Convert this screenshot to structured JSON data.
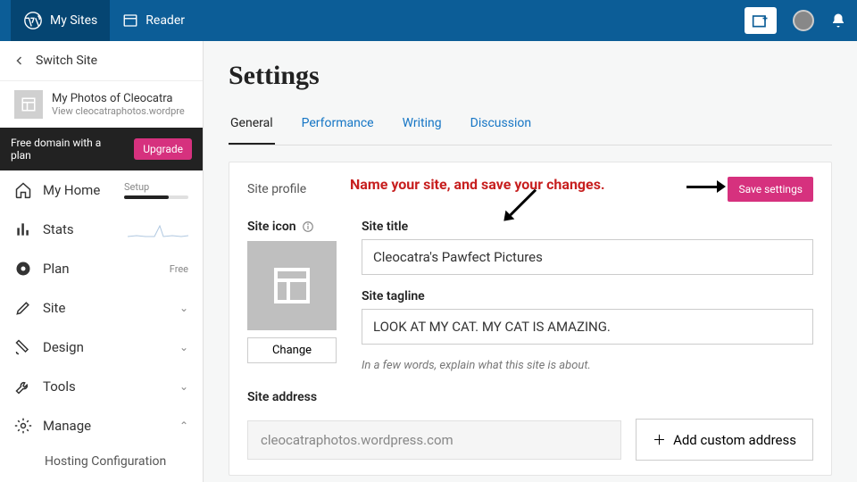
{
  "topbar": {
    "my_sites": "My Sites",
    "reader": "Reader"
  },
  "sidebar": {
    "switch_site": "Switch Site",
    "site_title": "My Photos of Cleocatra",
    "site_url": "View cleocatraphotos.wordpre",
    "upgrade_text": "Free domain with a plan",
    "upgrade_btn": "Upgrade",
    "items": {
      "home": {
        "label": "My Home",
        "meta": "Setup"
      },
      "stats": {
        "label": "Stats"
      },
      "plan": {
        "label": "Plan",
        "meta": "Free"
      },
      "site": {
        "label": "Site"
      },
      "design": {
        "label": "Design"
      },
      "tools": {
        "label": "Tools"
      },
      "manage": {
        "label": "Manage"
      }
    },
    "sub_hosting": "Hosting Configuration"
  },
  "main": {
    "title": "Settings",
    "tabs": {
      "general": "General",
      "performance": "Performance",
      "writing": "Writing",
      "discussion": "Discussion"
    },
    "profile": {
      "section_label": "Site profile",
      "save_btn": "Save settings",
      "annotation": "Name your site, and save your changes.",
      "site_icon_label": "Site icon",
      "change_btn": "Change",
      "site_title_label": "Site title",
      "site_title_value": "Cleocatra's Pawfect Pictures",
      "site_tagline_label": "Site tagline",
      "site_tagline_value": "LOOK AT MY CAT. MY CAT IS AMAZING.",
      "tagline_hint": "In a few words, explain what this site is about.",
      "site_address_label": "Site address",
      "site_address_value": "cleocatraphotos.wordpress.com",
      "custom_address_btn": "Add custom address"
    }
  }
}
